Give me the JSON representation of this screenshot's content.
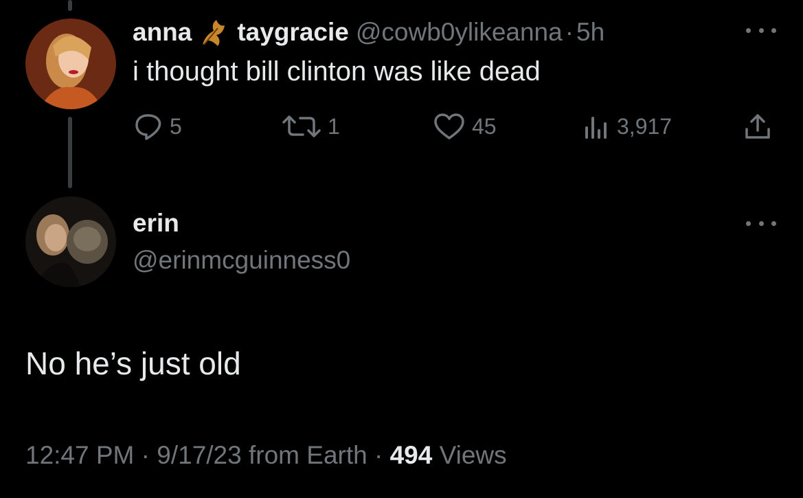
{
  "tweet": {
    "display_name": "anna",
    "display_name_2": "taygracie",
    "handle": "@cowb0ylikeanna",
    "separator": "·",
    "time": "5h",
    "text": "i thought bill clinton was like dead",
    "replies": "5",
    "retweets": "1",
    "likes": "45",
    "views": "3,917"
  },
  "reply": {
    "display_name": "erin",
    "handle": "@erinmcguinness0",
    "text": "No he’s just old",
    "time": "12:47 PM",
    "date": "9/17/23",
    "source": "from Earth",
    "separator": "·",
    "views_count": "494",
    "views_label": "Views"
  },
  "colors": {
    "background": "#000000",
    "text_primary": "#e7e9ea",
    "text_muted": "#71767b",
    "leaf_accent": "#c8872a"
  },
  "icons": {
    "leaf": "autumn-leaf-emoji",
    "reply": "speech-bubble-icon",
    "retweet": "retweet-arrows-icon",
    "like": "heart-icon",
    "views": "bar-chart-icon",
    "share": "share-upload-icon",
    "more": "three-dots-icon"
  }
}
